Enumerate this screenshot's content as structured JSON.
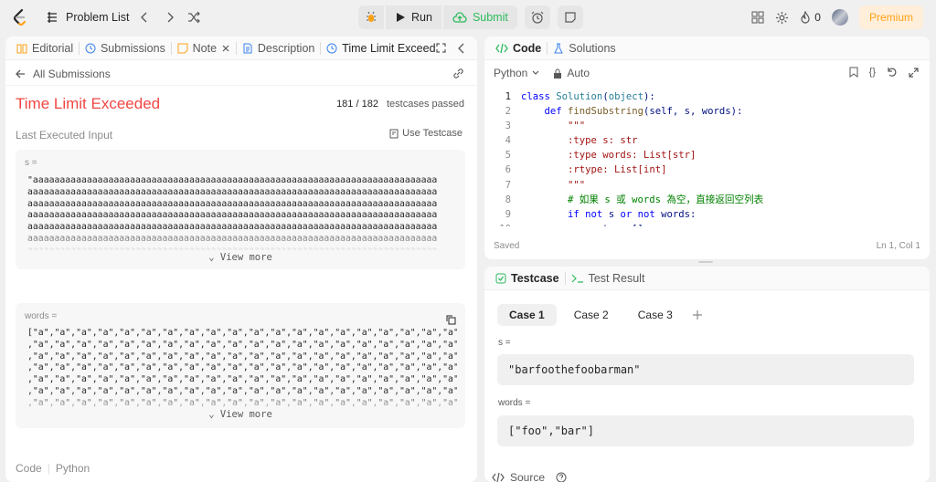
{
  "topbar": {
    "problem_list_label": "Problem List",
    "run_label": "Run",
    "submit_label": "Submit",
    "streak_count": "0",
    "premium_label": "Premium"
  },
  "left_tabs": [
    {
      "label": "Editorial",
      "icon": "book-icon"
    },
    {
      "label": "Submissions",
      "icon": "history-icon"
    },
    {
      "label": "Note",
      "icon": "note-icon"
    },
    {
      "label": "Description",
      "icon": "document-icon"
    },
    {
      "label": "Time Limit Exceede",
      "icon": "history-icon"
    }
  ],
  "submission": {
    "back_label": "All Submissions",
    "status": "Time Limit Exceeded",
    "testcases_passed": "181 / 182",
    "testcases_suffix": "testcases passed",
    "last_input_label": "Last Executed Input",
    "use_testcase_label": "Use Testcase",
    "s_label": "s =",
    "s_lines": [
      "\"aaaaaaaaaaaaaaaaaaaaaaaaaaaaaaaaaaaaaaaaaaaaaaaaaaaaaaaaaaaaaaaaaaaaaaaaaaa",
      "aaaaaaaaaaaaaaaaaaaaaaaaaaaaaaaaaaaaaaaaaaaaaaaaaaaaaaaaaaaaaaaaaaaaaaaaaaaa",
      "aaaaaaaaaaaaaaaaaaaaaaaaaaaaaaaaaaaaaaaaaaaaaaaaaaaaaaaaaaaaaaaaaaaaaaaaaaaa",
      "aaaaaaaaaaaaaaaaaaaaaaaaaaaaaaaaaaaaaaaaaaaaaaaaaaaaaaaaaaaaaaaaaaaaaaaaaaaa",
      "aaaaaaaaaaaaaaaaaaaaaaaaaaaaaaaaaaaaaaaaaaaaaaaaaaaaaaaaaaaaaaaaaaaaaaaaaaaa",
      "aaaaaaaaaaaaaaaaaaaaaaaaaaaaaaaaaaaaaaaaaaaaaaaaaaaaaaaaaaaaaaaaaaaaaaaaaaaa",
      "aaaaaaaaaaaaaaaaaaaaaaaaaaaaaaaaaaaaaaaaaaaaaaaaaaaaaaaaaaaaaaaaaaaaaaaaaaaa"
    ],
    "words_label": "words =",
    "words_lines": [
      "[\"a\",\"a\",\"a\",\"a\",\"a\",\"a\",\"a\",\"a\",\"a\",\"a\",\"a\",\"a\",\"a\",\"a\",\"a\",\"a\",\"a\",\"a\",\"a\",\"a\",\"a\",\"a\",\"a\",\"a\",\"a\"",
      ",\"a\",\"a\",\"a\",\"a\",\"a\",\"a\",\"a\",\"a\",\"a\",\"a\",\"a\",\"a\",\"a\",\"a\",\"a\",\"a\",\"a\",\"a\",\"a\",\"a\",\"a\",\"a\",\"a\",\"a\",\"a\"",
      ",\"a\",\"a\",\"a\",\"a\",\"a\",\"a\",\"a\",\"a\",\"a\",\"a\",\"a\",\"a\",\"a\",\"a\",\"a\",\"a\",\"a\",\"a\",\"a\",\"a\",\"a\",\"a\",\"a\",\"a\",\"a\"",
      ",\"a\",\"a\",\"a\",\"a\",\"a\",\"a\",\"a\",\"a\",\"a\",\"a\",\"a\",\"a\",\"a\",\"a\",\"a\",\"a\",\"a\",\"a\",\"a\",\"a\",\"a\",\"a\",\"a\",\"a\",\"a\"",
      ",\"a\",\"a\",\"a\",\"a\",\"a\",\"a\",\"a\",\"a\",\"a\",\"a\",\"a\",\"a\",\"a\",\"a\",\"a\",\"a\",\"a\",\"a\",\"a\",\"a\",\"a\",\"a\",\"a\",\"a\",\"a\"",
      ",\"a\",\"a\",\"a\",\"a\",\"a\",\"a\",\"a\",\"a\",\"a\",\"a\",\"a\",\"a\",\"a\",\"a\",\"a\",\"a\",\"a\",\"a\",\"a\",\"a\",\"a\",\"a\",\"a\",\"a\",\"a\"",
      ",\"a\",\"a\",\"a\",\"a\",\"a\",\"a\",\"a\",\"a\",\"a\",\"a\",\"a\",\"a\",\"a\",\"a\",\"a\",\"a\",\"a\",\"a\",\"a\",\"a\",\"a\",\"a\",\"a\",\"a\",\"a\""
    ],
    "view_more_label": "View more",
    "code_label": "Code",
    "lang_label": "Python"
  },
  "code_tabs": [
    {
      "label": "Code",
      "icon": "code-icon"
    },
    {
      "label": "Solutions",
      "icon": "flask-icon"
    }
  ],
  "editor": {
    "language": "Python",
    "mode": "Auto",
    "lines": [
      {
        "n": "1",
        "tokens": [
          [
            "kw",
            "class "
          ],
          [
            "cls",
            "Solution"
          ],
          [
            "p",
            "("
          ],
          [
            "cls",
            "object"
          ],
          [
            "p",
            "):"
          ]
        ]
      },
      {
        "n": "2",
        "tokens": [
          [
            "p",
            "    "
          ],
          [
            "kw",
            "def "
          ],
          [
            "fn",
            "findSubstring"
          ],
          [
            "p",
            "(self, s, words):"
          ]
        ]
      },
      {
        "n": "3",
        "tokens": [
          [
            "str",
            "        \"\"\""
          ]
        ]
      },
      {
        "n": "4",
        "tokens": [
          [
            "str",
            "        :type s: str"
          ]
        ]
      },
      {
        "n": "5",
        "tokens": [
          [
            "str",
            "        :type words: List[str]"
          ]
        ]
      },
      {
        "n": "6",
        "tokens": [
          [
            "str",
            "        :rtype: List[int]"
          ]
        ]
      },
      {
        "n": "7",
        "tokens": [
          [
            "str",
            "        \"\"\""
          ]
        ]
      },
      {
        "n": "8",
        "tokens": [
          [
            "cm",
            "        # 如果 s 或 words 為空，直接返回空列表"
          ]
        ]
      },
      {
        "n": "9",
        "tokens": [
          [
            "p",
            "        "
          ],
          [
            "kw",
            "if "
          ],
          [
            "kw",
            "not "
          ],
          [
            "p",
            "s "
          ],
          [
            "kw",
            "or "
          ],
          [
            "kw",
            "not "
          ],
          [
            "p",
            "words:"
          ]
        ]
      },
      {
        "n": "10",
        "tokens": [
          [
            "p",
            "            return []"
          ]
        ]
      }
    ],
    "status_left": "Saved",
    "status_right": "Ln 1, Col 1"
  },
  "test_tabs": [
    {
      "label": "Testcase",
      "icon": "checkbox-icon"
    },
    {
      "label": "Test Result",
      "icon": "terminal-icon"
    }
  ],
  "testcase": {
    "cases": [
      "Case 1",
      "Case 2",
      "Case 3"
    ],
    "s_label": "s =",
    "s_value": "\"barfoothefoobarman\"",
    "words_label": "words =",
    "words_value": "[\"foo\",\"bar\"]",
    "source_label": "Source"
  },
  "colors": {
    "error": "#ef4743",
    "success": "#2cbb5d",
    "premium": "#ffa116",
    "keyword": "#0000ff",
    "class_name": "#267f99",
    "string": "#a31515",
    "comment": "#008000"
  }
}
